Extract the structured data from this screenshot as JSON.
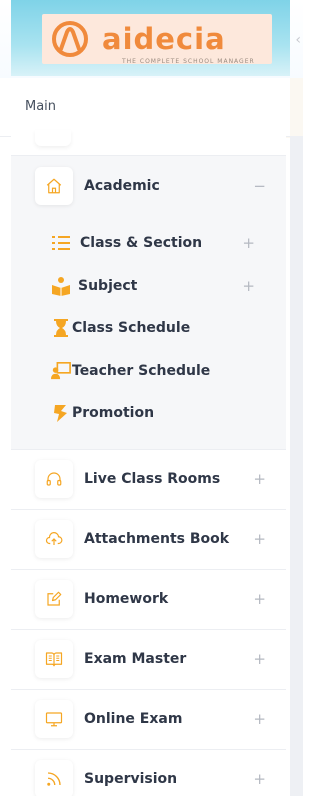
{
  "brand": {
    "name": "aidecia",
    "tagline": "THE COMPLETE SCHOOL MANAGER",
    "accent": "#f08a3c"
  },
  "sidebar": {
    "section_label": "Main",
    "collapse_icon": "‹",
    "items": [
      {
        "label": "Academic",
        "icon": "home-icon",
        "toggle": "−",
        "expanded": true,
        "children": [
          {
            "label": "Class & Section",
            "icon": "list-icon",
            "toggle": "+"
          },
          {
            "label": "Subject",
            "icon": "book-reader-icon",
            "toggle": "+"
          },
          {
            "label": "Class Schedule",
            "icon": "hourglass-icon",
            "toggle": ""
          },
          {
            "label": "Teacher Schedule",
            "icon": "teacher-board-icon",
            "toggle": ""
          },
          {
            "label": "Promotion",
            "icon": "promotion-icon",
            "toggle": ""
          }
        ]
      },
      {
        "label": "Live Class Rooms",
        "icon": "headphones-icon",
        "toggle": "+"
      },
      {
        "label": "Attachments Book",
        "icon": "cloud-upload-icon",
        "toggle": "+"
      },
      {
        "label": "Homework",
        "icon": "edit-icon",
        "toggle": "+"
      },
      {
        "label": "Exam Master",
        "icon": "open-book-icon",
        "toggle": "+"
      },
      {
        "label": "Online Exam",
        "icon": "monitor-icon",
        "toggle": "+"
      },
      {
        "label": "Supervision",
        "icon": "rss-icon",
        "toggle": "+"
      }
    ]
  },
  "colors": {
    "icon_orange": "#f5a623",
    "text": "#2f3747",
    "muted": "#b5b9c2",
    "open_bg": "#f6f7f9"
  }
}
